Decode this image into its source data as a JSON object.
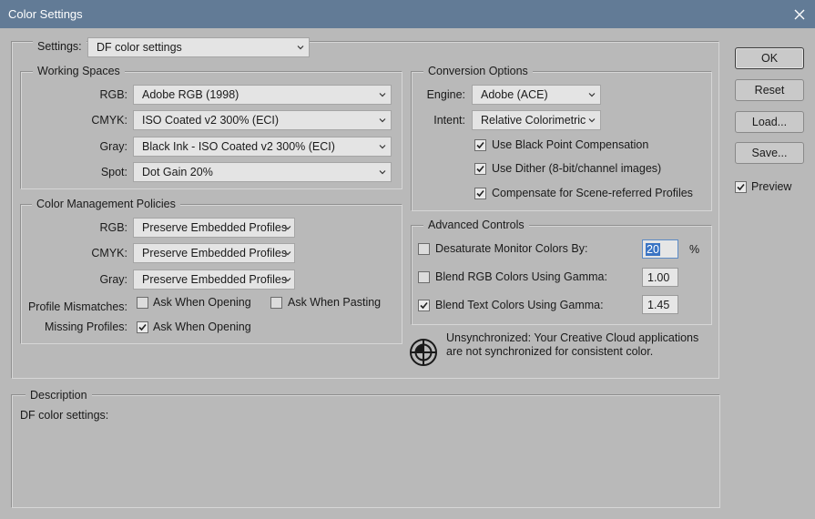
{
  "window": {
    "title": "Color Settings"
  },
  "settings": {
    "label": "Settings:",
    "value": "DF color settings"
  },
  "working_spaces": {
    "title": "Working Spaces",
    "rgb": {
      "label": "RGB:",
      "value": "Adobe RGB (1998)"
    },
    "cmyk": {
      "label": "CMYK:",
      "value": "ISO Coated v2 300% (ECI)"
    },
    "gray": {
      "label": "Gray:",
      "value": "Black Ink - ISO Coated v2 300% (ECI)"
    },
    "spot": {
      "label": "Spot:",
      "value": "Dot Gain 20%"
    }
  },
  "policies": {
    "title": "Color Management Policies",
    "rgb": {
      "label": "RGB:",
      "value": "Preserve Embedded Profiles"
    },
    "cmyk": {
      "label": "CMYK:",
      "value": "Preserve Embedded Profiles"
    },
    "gray": {
      "label": "Gray:",
      "value": "Preserve Embedded Profiles"
    },
    "profile_mismatches": {
      "label": "Profile Mismatches:",
      "ask_opening": "Ask When Opening",
      "ask_opening_checked": false,
      "ask_pasting": "Ask When Pasting",
      "ask_pasting_checked": false
    },
    "missing_profiles": {
      "label": "Missing Profiles:",
      "ask_opening": "Ask When Opening",
      "ask_opening_checked": true
    }
  },
  "conversion": {
    "title": "Conversion Options",
    "engine": {
      "label": "Engine:",
      "value": "Adobe (ACE)"
    },
    "intent": {
      "label": "Intent:",
      "value": "Relative Colorimetric"
    },
    "black_point": {
      "label": "Use Black Point Compensation",
      "checked": true
    },
    "dither": {
      "label": "Use Dither (8-bit/channel images)",
      "checked": true
    },
    "scene_referred": {
      "label": "Compensate for Scene-referred Profiles",
      "checked": true
    }
  },
  "advanced": {
    "title": "Advanced Controls",
    "desaturate": {
      "label": "Desaturate Monitor Colors By:",
      "value": "20",
      "unit": "%",
      "checked": false
    },
    "blend_rgb": {
      "label": "Blend RGB Colors Using Gamma:",
      "value": "1.00",
      "checked": false
    },
    "blend_text": {
      "label": "Blend Text Colors Using Gamma:",
      "value": "1.45",
      "checked": true
    }
  },
  "sync": {
    "line1": "Unsynchronized: Your Creative Cloud applications",
    "line2": "are not synchronized for consistent color."
  },
  "buttons": {
    "ok": "OK",
    "reset": "Reset",
    "load": "Load...",
    "save": "Save..."
  },
  "preview": {
    "label": "Preview",
    "checked": true
  },
  "description": {
    "title": "Description",
    "text": "DF color settings:"
  },
  "colors": {
    "titlebar": "#627b96",
    "dialog_bg": "#b9b9b9",
    "focus_selection": "#3a74c4"
  }
}
